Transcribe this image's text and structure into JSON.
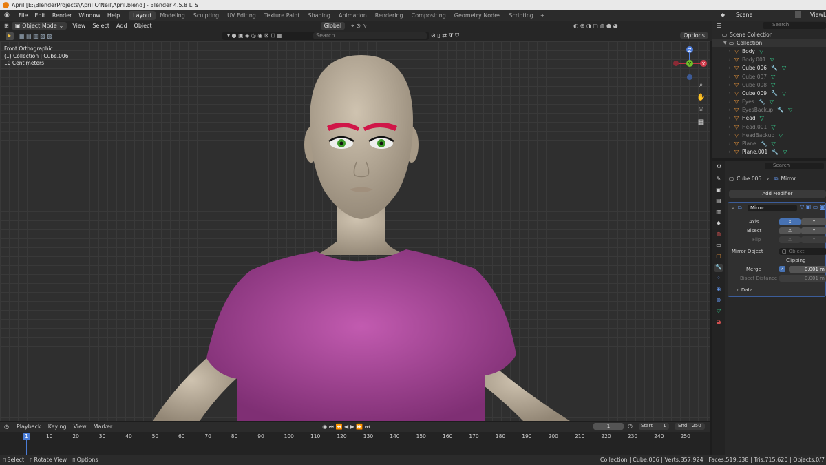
{
  "window": {
    "title": "April [E:\\BlenderProjects\\April O'Neil\\April.blend] - Blender 4.5.8 LTS"
  },
  "menu": [
    "File",
    "Edit",
    "Render",
    "Window",
    "Help"
  ],
  "workspaces": [
    "Layout",
    "Modeling",
    "Sculpting",
    "UV Editing",
    "Texture Paint",
    "Shading",
    "Animation",
    "Rendering",
    "Compositing",
    "Geometry Nodes",
    "Scripting"
  ],
  "workspace_add": "+",
  "scene": {
    "name": "Scene",
    "view_layer": "ViewLay"
  },
  "viewport_header": {
    "mode": "Object Mode",
    "view": "View",
    "select": "Select",
    "add": "Add",
    "object": "Object",
    "orientation": "Global",
    "options": "Options",
    "search_placeholder": "Search"
  },
  "viewport_info": {
    "line1": "Front Orthographic",
    "line2": "(1) Collection | Cube.006",
    "line3": "10 Centimeters"
  },
  "gizmo": {
    "z": "Z",
    "y": "Y",
    "x": "X"
  },
  "outliner": {
    "search_placeholder": "Search",
    "root": "Scene Collection",
    "collection": "Collection",
    "items": [
      {
        "name": "Body",
        "dim": false,
        "modifier": false
      },
      {
        "name": "Body.001",
        "dim": true,
        "modifier": false
      },
      {
        "name": "Cube.006",
        "dim": false,
        "modifier": true
      },
      {
        "name": "Cube.007",
        "dim": true,
        "modifier": false
      },
      {
        "name": "Cube.008",
        "dim": true,
        "modifier": false
      },
      {
        "name": "Cube.009",
        "dim": false,
        "modifier": true
      },
      {
        "name": "Eyes",
        "dim": true,
        "modifier": true
      },
      {
        "name": "EyesBackup",
        "dim": true,
        "modifier": true
      },
      {
        "name": "Head",
        "dim": false,
        "modifier": false
      },
      {
        "name": "Head.001",
        "dim": true,
        "modifier": false
      },
      {
        "name": "HeadBackup",
        "dim": true,
        "modifier": false
      },
      {
        "name": "Plane",
        "dim": true,
        "modifier": true
      },
      {
        "name": "Plane.001",
        "dim": false,
        "modifier": true
      }
    ]
  },
  "properties": {
    "search_placeholder": "Search",
    "breadcrumb_object": "Cube.006",
    "breadcrumb_modifier": "Mirror",
    "add_modifier": "Add Modifier",
    "modifier_name": "Mirror",
    "axis_label": "Axis",
    "bisect_label": "Bisect",
    "flip_label": "Flip",
    "x": "X",
    "y": "Y",
    "mirror_object_label": "Mirror Object",
    "mirror_object_placeholder": "Object",
    "clipping": "Clipping",
    "merge_label": "Merge",
    "merge_value": "0.001 m",
    "bisect_distance_label": "Bisect Distance",
    "bisect_distance_value": "0.001 m",
    "data_panel": "Data"
  },
  "timeline": {
    "playback": "Playback",
    "keying": "Keying",
    "view": "View",
    "marker": "Marker",
    "current_frame": "1",
    "start_label": "Start",
    "start": "1",
    "end_label": "End",
    "end": "250",
    "ticks": [
      "1",
      "10",
      "20",
      "30",
      "40",
      "50",
      "60",
      "70",
      "80",
      "90",
      "100",
      "110",
      "120",
      "130",
      "140",
      "150",
      "160",
      "170",
      "180",
      "190",
      "200",
      "210",
      "220",
      "230",
      "240",
      "250"
    ]
  },
  "statusbar": {
    "select": "Select",
    "rotate": "Rotate View",
    "options": "Options",
    "stats": "Collection | Cube.006 | Verts:357,924 | Faces:519,538 | Tris:715,620 | Objects:0/7"
  },
  "colors": {
    "accent": "#4772b3",
    "orange": "#e8943a",
    "mesh": "#34c98a",
    "shirt": "#b0479e",
    "skin": "#b9ab97",
    "brows": "#d01648",
    "irises": "#3e9a2c"
  }
}
